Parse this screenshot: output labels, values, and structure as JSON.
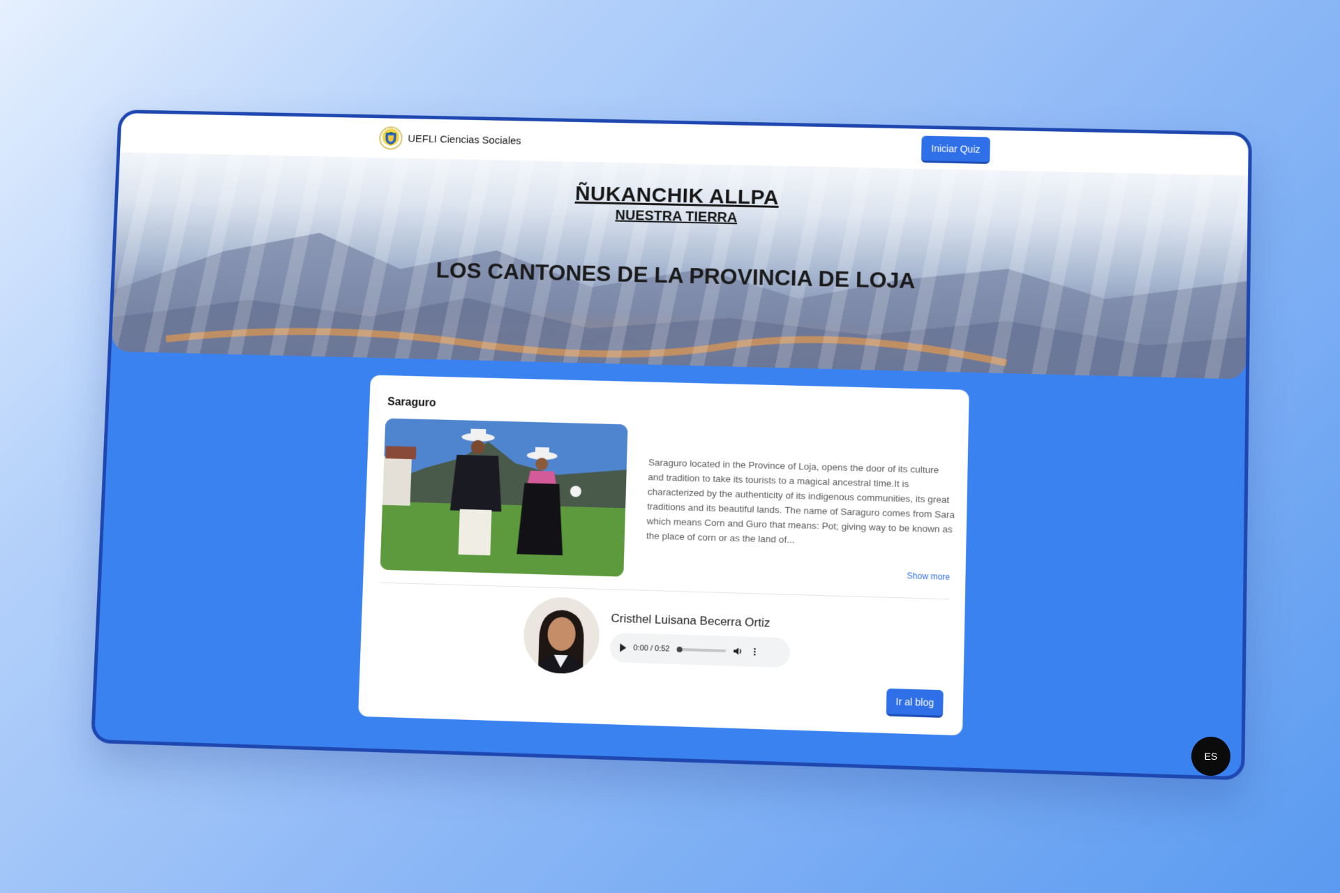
{
  "nav": {
    "brand": "UEFLI Ciencias Sociales",
    "quiz_button": "Iniciar Quiz"
  },
  "hero": {
    "title": "ÑUKANCHIK ALLPA",
    "subtitle": "NUESTRA TIERRA",
    "heading": "LOS CANTONES DE LA PROVINCIA DE LOJA"
  },
  "card": {
    "title": "Saraguro",
    "description": "Saraguro located in the Province of Loja, opens the door of its culture and tradition to take its tourists to a magical ancestral time.It is characterized by the authenticity of its indigenous communities, its great traditions and its beautiful lands. The name of Saraguro comes from Sara which means Corn and Guro that means: Pot; giving way to be known as the place of corn or as the land of...",
    "show_more": "Show more",
    "author": "Cristhel Luisana Becerra Ortiz",
    "audio_time": "0:00 / 0:52",
    "audio_progress": 0,
    "blog_button": "Ir al blog"
  },
  "language_button": "ES",
  "colors": {
    "accent": "#2f6fe8",
    "frame_border": "#1f47b0",
    "page_bg": "#3b82f1"
  },
  "icons": [
    "school-crest-icon",
    "play-icon",
    "volume-icon",
    "more-vert-icon"
  ]
}
